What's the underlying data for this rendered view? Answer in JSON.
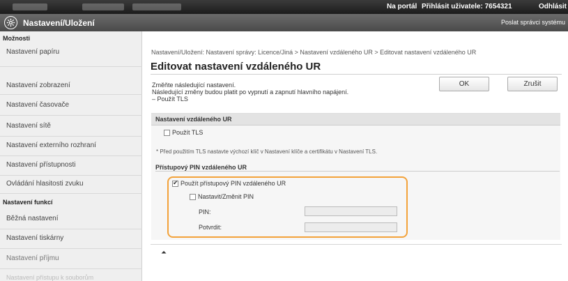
{
  "topbar": {
    "portal_link": "Na portál",
    "login_user_label": "Přihlásit uživatele: 7654321",
    "logout_link": "Odhlásit"
  },
  "titlebar": {
    "title": "Nastavení/Uložení",
    "mail_admin": "Poslat správci systému"
  },
  "sidebar": {
    "section1": "Možnosti",
    "section1_items": [
      "Nastavení papíru",
      "Nastavení zobrazení",
      "Nastavení časovače",
      "Nastavení sítě",
      "Nastavení externího rozhraní",
      "Nastavení přístupnosti",
      "Ovládání hlasitosti zvuku"
    ],
    "section2": "Nastavení funkcí",
    "section2_items": [
      "Běžná nastavení",
      "Nastavení tiskárny",
      "Nastavení příjmu",
      "Nastavení přístupu k souborům"
    ]
  },
  "main": {
    "breadcrumb": "Nastavení/Uložení: Nastavení správy: Licence/Jiná > Nastavení vzdáleného UR > Editovat nastavení vzdáleného UR",
    "page_title": "Editovat nastavení vzdáleného UR",
    "info_lines": [
      "Změňte následující nastavení.",
      "Následující změny budou platit po vypnutí a zapnutí hlavního napájení.",
      "– Použít TLS"
    ],
    "ok_label": "OK",
    "cancel_label": "Zrušit",
    "panel_header": "Nastavení vzdáleného UR",
    "use_tls_label": "Použít TLS",
    "use_tls_checked": false,
    "tls_note": "* Před použitím TLS nastavte výchozí klíč v Nastavení klíče a certifikátu v Nastavení TLS.",
    "pin_section_title": "Přístupový PIN vzdáleného UR",
    "use_pin_label": "Použít přístupový PIN vzdáleného UR",
    "use_pin_checked": true,
    "set_change_pin_label": "Nastavit/Změnit PIN",
    "set_change_pin_checked": false,
    "pin_label": "PIN:",
    "pin_value": "",
    "confirm_label": "Potvrdit:",
    "confirm_value": "",
    "to_top_glyph": "⏶"
  },
  "colors": {
    "highlight": "#f3a23a",
    "topbar": "#2a2a2a",
    "titlebar": "#5a5a5a"
  }
}
